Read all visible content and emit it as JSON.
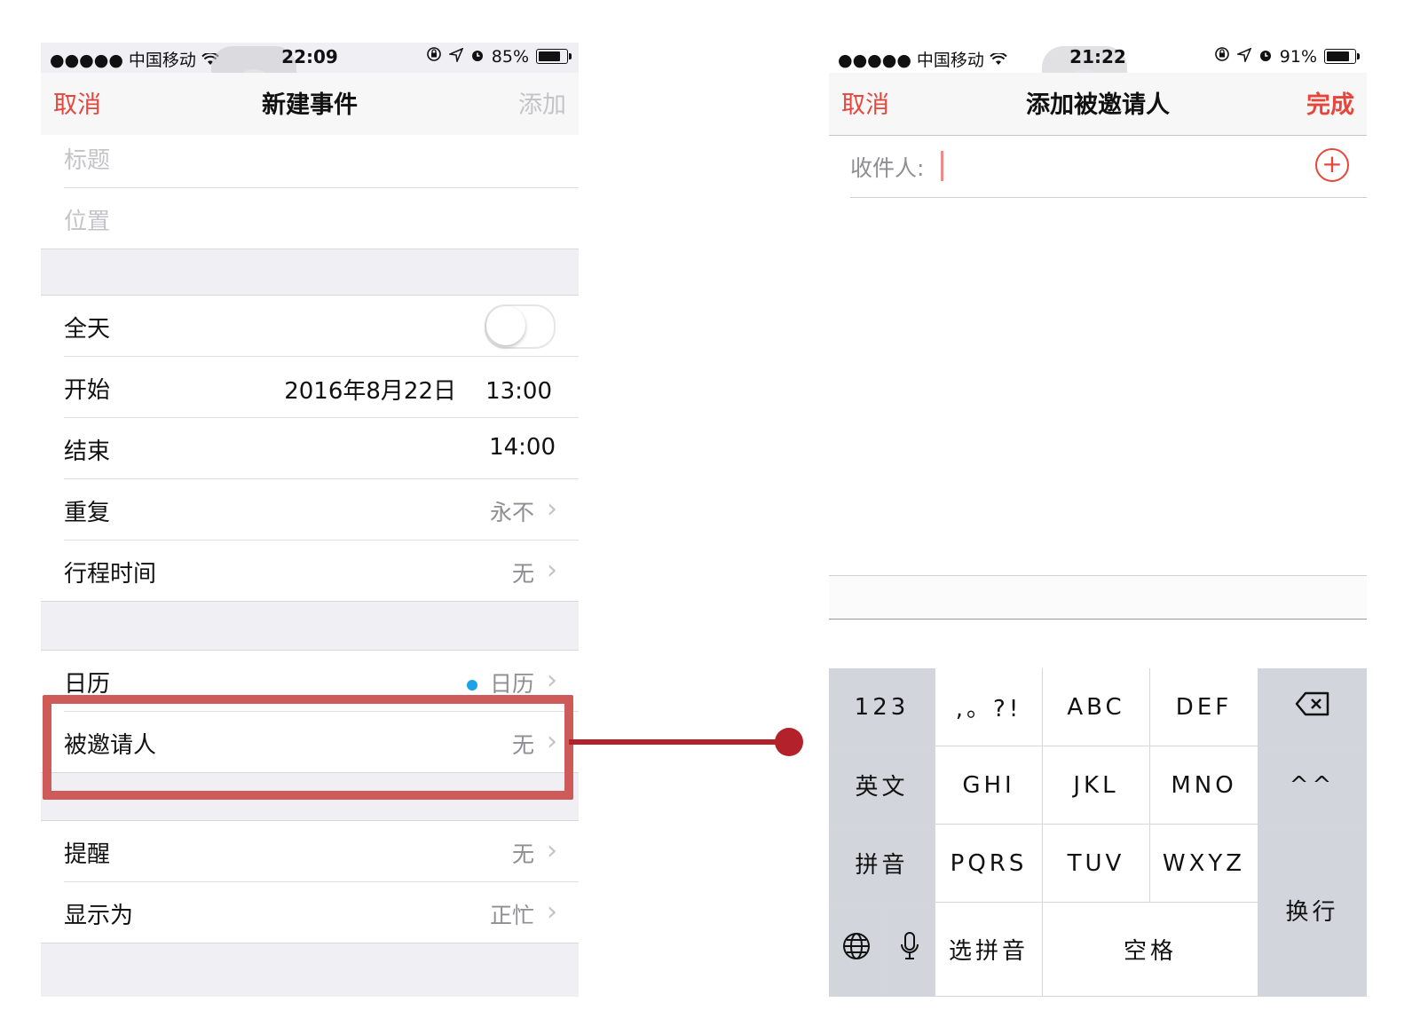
{
  "left_screen": {
    "status": {
      "carrier": "●●●●● 中国移动",
      "time": "22:09",
      "battery": "85%",
      "battery_level": 0.85
    },
    "nav": {
      "cancel": "取消",
      "title": "新建事件",
      "add": "添加"
    },
    "fields": {
      "title_placeholder": "标题",
      "location_placeholder": "位置"
    },
    "rows": {
      "all_day": {
        "label": "全天",
        "on": false
      },
      "start": {
        "label": "开始",
        "date": "2016年8月22日",
        "time": "13:00"
      },
      "end": {
        "label": "结束",
        "time": "14:00"
      },
      "repeat": {
        "label": "重复",
        "value": "永不"
      },
      "travel": {
        "label": "行程时间",
        "value": "无"
      },
      "calendar": {
        "label": "日历",
        "value": "日历",
        "dot_color": "#1aa3e8"
      },
      "invitees": {
        "label": "被邀请人",
        "value": "无"
      },
      "alert": {
        "label": "提醒",
        "value": "无"
      },
      "show_as": {
        "label": "显示为",
        "value": "正忙"
      }
    }
  },
  "right_screen": {
    "status": {
      "carrier": "●●●●● 中国移动",
      "time": "21:22",
      "battery": "91%",
      "battery_level": 0.91
    },
    "nav": {
      "cancel": "取消",
      "title": "添加被邀请人",
      "done": "完成"
    },
    "recipient_label": "收件人:",
    "keyboard": {
      "row1": [
        "123",
        ",。?!",
        "ABC",
        "DEF",
        "⌫"
      ],
      "row2": [
        "英文",
        "GHI",
        "JKL",
        "MNO",
        "^^"
      ],
      "row3": [
        "拼音",
        "PQRS",
        "TUV",
        "WXYZ"
      ],
      "enter": "换行",
      "row4": {
        "select_pinyin": "选拼音",
        "space": "空格"
      }
    }
  },
  "colors": {
    "accent": "#e6463c",
    "highlight": "#cf5a5a",
    "connector": "#b3222a"
  }
}
